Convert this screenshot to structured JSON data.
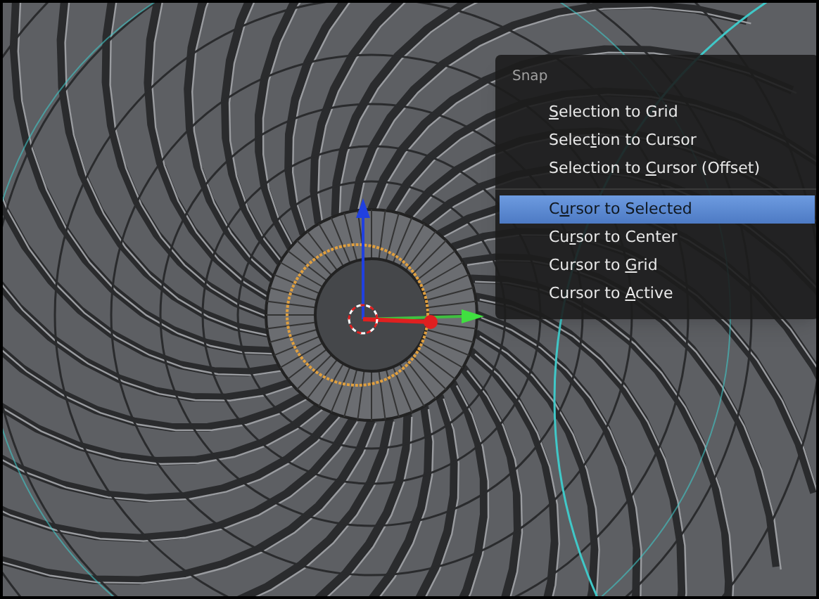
{
  "menu": {
    "title": "Snap",
    "groups": [
      {
        "items": [
          {
            "key": "S",
            "after": "election to Grid",
            "selected": false
          },
          {
            "before": "Selec",
            "key": "t",
            "after": "ion to Cursor",
            "selected": false
          },
          {
            "before": "Selection to ",
            "key": "C",
            "after": "ursor (Offset)",
            "selected": false
          }
        ]
      },
      {
        "items": [
          {
            "before": "C",
            "key": "u",
            "after": "rsor to Selected",
            "selected": true
          },
          {
            "before": "Cu",
            "key": "r",
            "after": "sor to Center",
            "selected": false
          },
          {
            "before": "Cursor to ",
            "key": "G",
            "after": "rid",
            "selected": false
          },
          {
            "before": "Cursor to ",
            "key": "A",
            "after": "ctive",
            "selected": false
          }
        ]
      }
    ]
  }
}
